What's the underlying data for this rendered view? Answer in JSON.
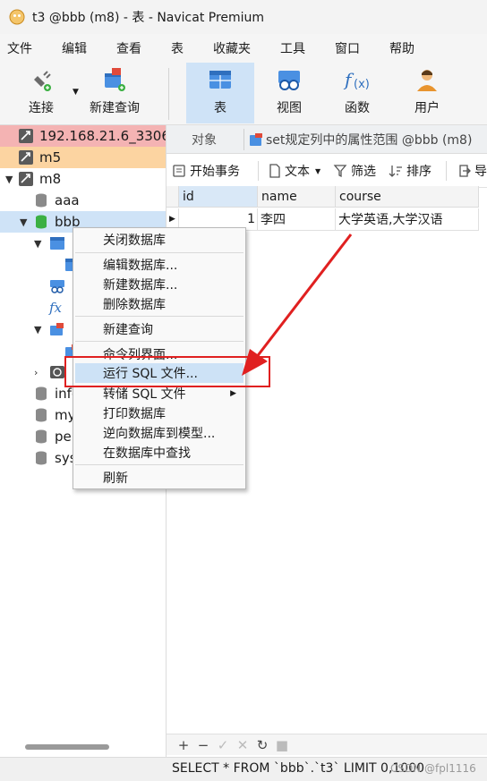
{
  "window": {
    "title": "t3 @bbb (m8) - 表 - Navicat Premium"
  },
  "menu": [
    "文件",
    "编辑",
    "查看",
    "表",
    "收藏夹",
    "工具",
    "窗口",
    "帮助"
  ],
  "toolbar": {
    "connect": "连接",
    "new_query": "新建查询",
    "table": "表",
    "view": "视图",
    "function": "函数",
    "user": "用户"
  },
  "tree": {
    "conn1": "192.168.21.6_3306",
    "conn2": "m5",
    "conn3": "m8",
    "db_aaa": "aaa",
    "db_bbb": "bbb",
    "db_info": "info",
    "db_my": "my",
    "db_pe": "pe",
    "db_sys": "sys"
  },
  "tabs": {
    "objects": "对象",
    "doc": "set规定列中的属性范围 @bbb (m8)"
  },
  "obj_toolbar": {
    "begin_tx": "开始事务",
    "text": "文本",
    "filter": "筛选",
    "sort": "排序",
    "export": "导"
  },
  "grid": {
    "columns": [
      "id",
      "name",
      "course"
    ],
    "rows": [
      {
        "id": "1",
        "name": "李四",
        "course": "大学英语,大学汉语"
      }
    ]
  },
  "context_menu": {
    "close_db": "关闭数据库",
    "edit_db": "编辑数据库...",
    "new_db": "新建数据库...",
    "delete_db": "删除数据库",
    "new_query": "新建查询",
    "console": "命令列界面...",
    "run_sql": "运行 SQL 文件...",
    "dump_sql": "转储 SQL 文件",
    "print_db": "打印数据库",
    "reverse": "逆向数据库到模型...",
    "find": "在数据库中查找",
    "refresh": "刷新"
  },
  "status": {
    "sql": "SELECT * FROM `bbb`.`t3` LIMIT 0,1000",
    "watermark": "CSDN @fpl1116"
  },
  "colors": {
    "accent": "#cfe3f7",
    "annotation": "#e02020",
    "conn_red": "#f4b3b3",
    "conn_orange": "#fcd4a1"
  }
}
